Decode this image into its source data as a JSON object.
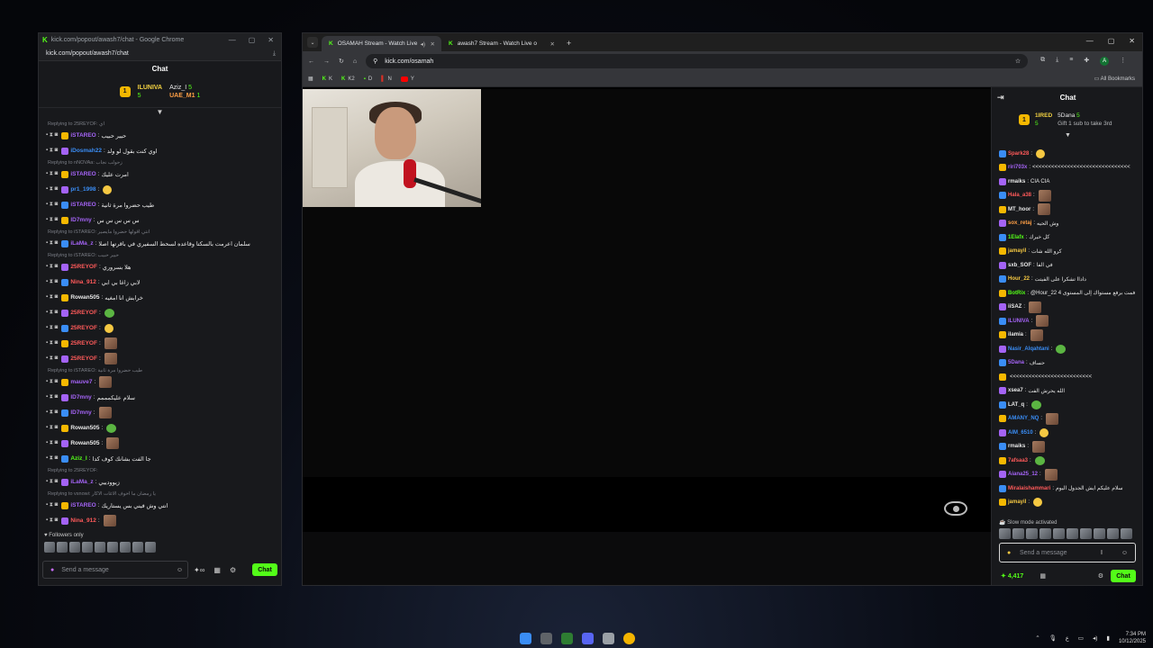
{
  "popout": {
    "window_title": "kick.com/popout/awash7/chat - Google Chrome",
    "url": "kick.com/popout/awash7/chat",
    "heading": "Chat",
    "pinned": [
      {
        "rank": "1",
        "name": "ILUNIVA",
        "count": "5"
      },
      {
        "name": "Aziz_I",
        "count": "5"
      },
      {
        "name": "UAE_M1",
        "count": "1"
      }
    ],
    "messages": [
      {
        "reply": "Replying to 25REYOF: اي"
      },
      {
        "user": "iSTAREO",
        "color": "#a463f5",
        "text": "حيير حبيب"
      },
      {
        "user": "iDosmah22",
        "color": "#3a8df5",
        "text": "اوي كنت بقول لو ولد"
      },
      {
        "reply": "Replying to nNOVAa: زحولب نجاب"
      },
      {
        "user": "iSTAREO",
        "color": "#a463f5",
        "text": "امرت عليك"
      },
      {
        "user": "pr1_1998",
        "color": "#3a8df5",
        "text": ""
      },
      {
        "user": "iSTAREO",
        "color": "#a463f5",
        "text": "طيب حضروا مرة ثانية"
      },
      {
        "user": "lD7mny",
        "color": "#a463f5",
        "text": "س س س س س"
      },
      {
        "reply": "Replying to iSTAREO: انتي اقولها حضروا مايصير"
      },
      {
        "user": "iLaMa_z",
        "color": "#a463f5",
        "text": "سلمان اعرمت بالسكتا وقاعده لسحط السفيري في باقرتها اصلا"
      },
      {
        "reply": "Replying to iSTAREO: حيير حبيب"
      },
      {
        "user": "25REYOF",
        "color": "#ff5a5a",
        "text": "هلا بسروري"
      },
      {
        "user": "Nina_912",
        "color": "#ff5a5a",
        "text": "لابي زاغا بي ابي"
      },
      {
        "user": "Rowan505",
        "color": "#e8e8e8",
        "text": "خرابش انا امغيه"
      },
      {
        "user": "25REYOF",
        "color": "#ff5a5a",
        "text": ""
      },
      {
        "user": "25REYOF",
        "color": "#ff5a5a",
        "text": ""
      },
      {
        "user": "25REYOF",
        "color": "#ff5a5a",
        "text": ""
      },
      {
        "user": "25REYOF",
        "color": "#ff5a5a",
        "text": ""
      },
      {
        "reply": "Replying to iSTAREO: طيب حضروا مرة ثانية"
      },
      {
        "user": "mauve7",
        "color": "#a463f5",
        "text": ""
      },
      {
        "user": "lD7mny",
        "color": "#a463f5",
        "text": "سلام عليكمممم"
      },
      {
        "user": "lD7mny",
        "color": "#a463f5",
        "text": ""
      },
      {
        "user": "Rowan505",
        "color": "#e8e8e8",
        "text": ""
      },
      {
        "user": "Rowan505",
        "color": "#e8e8e8",
        "text": ""
      },
      {
        "user": "Aziz_I",
        "color": "#53fc18",
        "text": "جا الفت بشانك كوف كدا"
      },
      {
        "reply": "Replying to 25REYOF:"
      },
      {
        "user": "iLaMa_z",
        "color": "#a463f5",
        "text": "زيوودييي"
      },
      {
        "reply": "Replying to vsnowi: يا رمضان ما اخوف الاغات الاكار"
      },
      {
        "user": "iSTAREO",
        "color": "#a463f5",
        "text": "انتي وش فيني بس يستاريك"
      },
      {
        "user": "Nina_912",
        "color": "#ff5a5a",
        "text": ""
      }
    ],
    "followers_label": "Followers only",
    "input_placeholder": "Send a message",
    "chat_button": "Chat"
  },
  "browser": {
    "tabs": [
      {
        "label": "OSAMAH Stream - Watch Live",
        "active": true
      },
      {
        "label": "awash7 Stream - Watch Live o",
        "active": false
      }
    ],
    "url": "kick.com/osamah",
    "bookmarks": [
      "K",
      "K2",
      "D",
      "N",
      "Y"
    ],
    "all_bookmarks": "All Bookmarks"
  },
  "side_chat": {
    "heading": "Chat",
    "pinned": [
      {
        "rank": "1",
        "name": "1IRED",
        "count": "5"
      },
      {
        "name": "5Dana",
        "count": "5"
      },
      {
        "gift_text": "Gift 1 sub to take 3rd"
      }
    ],
    "messages": [
      {
        "user": "Spark28",
        "color": "#ff5a5a",
        "text": ""
      },
      {
        "user": "riri703x",
        "color": "#a463f5",
        "text": "<<<<<<<<<<<<<<<<<<<<<<<<<<<<<<<"
      },
      {
        "user": "rmaiks",
        "color": "#e8e8e8",
        "text": "CIA CIA"
      },
      {
        "user": "Hala_a38",
        "color": "#ff5a5a",
        "text": ""
      },
      {
        "user": "MT_hoor",
        "color": "#e8e8e8",
        "text": ""
      },
      {
        "user": "sox_retaj",
        "color": "#ff9f45",
        "text": "وش الحيه"
      },
      {
        "user": "1Elafx",
        "color": "#53fc18",
        "text": "كل خيرك"
      },
      {
        "user": "jamayil",
        "color": "#f5c842",
        "text": "كرو الله شات"
      },
      {
        "user": "sxb_SOF",
        "color": "#e8e8e8",
        "text": "في الفا"
      },
      {
        "user": "Hour_22",
        "color": "#f5c842",
        "text": "داداا تشكرا على الفيتت"
      },
      {
        "user": "BotRix",
        "color": "#53fc18",
        "text": "@Hour_22 فمت برفع مستواك إلى المستوى 4"
      },
      {
        "user": "iiSAZ",
        "color": "#e8e8e8",
        "text": ""
      },
      {
        "user": "ILUNIVA",
        "color": "#a463f5",
        "text": ""
      },
      {
        "user": "ilamia",
        "color": "#e8e8e8",
        "text": ""
      },
      {
        "user": "Nasir_Alqahtani",
        "color": "#3a8df5",
        "text": ""
      },
      {
        "user": "5Dana",
        "color": "#a463f5",
        "text": "حساف"
      },
      {
        "user": "",
        "color": "#e8e8e8",
        "text": "<<<<<<<<<<<<<<<<<<<<<<<<<<"
      },
      {
        "user": "xsea7",
        "color": "#e8e8e8",
        "text": "الله يحرش الفت"
      },
      {
        "user": "LAT_q",
        "color": "#e8e8e8",
        "text": ""
      },
      {
        "user": "AMANY_NQ",
        "color": "#3a8df5",
        "text": ""
      },
      {
        "user": "AIM_6510",
        "color": "#3a8df5",
        "text": ""
      },
      {
        "user": "rmaiks",
        "color": "#e8e8e8",
        "text": ""
      },
      {
        "user": "7afsaa3",
        "color": "#ff5a5a",
        "text": ""
      },
      {
        "user": "Aiana25_12",
        "color": "#a463f5",
        "text": ""
      },
      {
        "user": "Miralaishammari",
        "color": "#ff5a5a",
        "text": "سلام عليكم ايش الجدول اليوم"
      },
      {
        "user": "jamayil",
        "color": "#f5c842",
        "text": ""
      }
    ],
    "slow_mode": "Slow mode activated",
    "input_placeholder": "Send a message",
    "points": "4,417",
    "chat_button": "Chat"
  },
  "taskbar": {
    "tray_lang": "ع",
    "time": "7:34 PM",
    "date": "10/12/2025"
  }
}
